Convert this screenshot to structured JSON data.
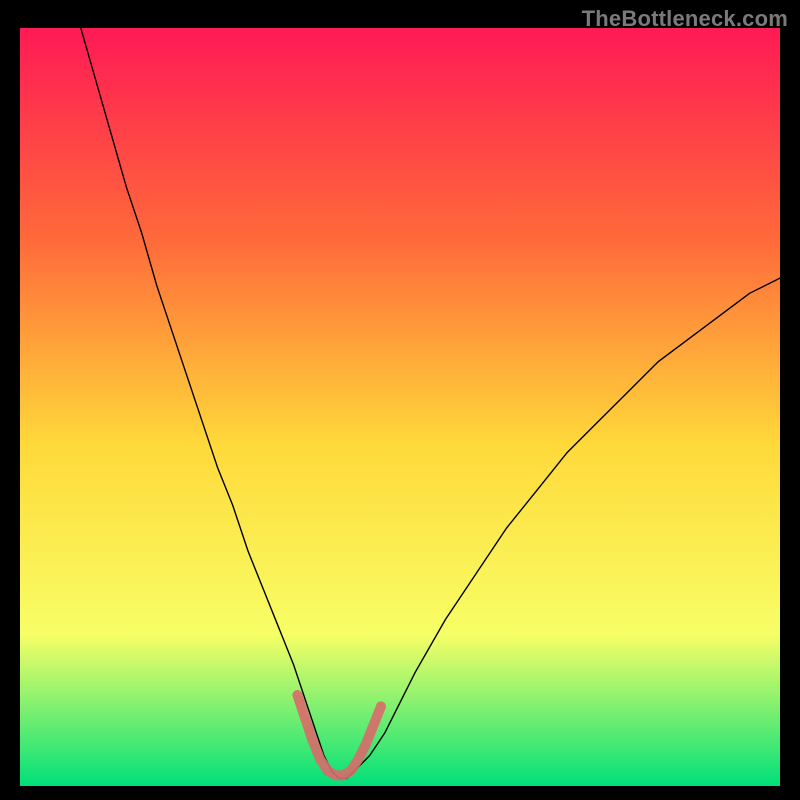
{
  "watermark": "TheBottleneck.com",
  "chart_data": {
    "type": "line",
    "title": "",
    "xlabel": "",
    "ylabel": "",
    "xlim": [
      0,
      100
    ],
    "ylim": [
      0,
      100
    ],
    "grid": false,
    "legend": false,
    "background_gradient": {
      "top": "#ff1a55",
      "mid_upper": "#ff6a3a",
      "mid": "#ffd93a",
      "lower_mid": "#f7ff66",
      "bottom": "#00e07a"
    },
    "series": [
      {
        "name": "bottleneck-curve",
        "stroke": "#000000",
        "stroke_width": 1.4,
        "x": [
          8,
          10,
          12,
          14,
          16,
          18,
          20,
          22,
          24,
          26,
          28,
          30,
          32,
          34,
          36,
          38,
          39,
          40,
          41,
          42,
          43,
          44,
          46,
          48,
          50,
          52,
          56,
          60,
          64,
          68,
          72,
          76,
          80,
          84,
          88,
          92,
          96,
          100
        ],
        "y": [
          100,
          93,
          86,
          79,
          73,
          66,
          60,
          54,
          48,
          42,
          37,
          31,
          26,
          21,
          16,
          10,
          7,
          4,
          2,
          1,
          1,
          2,
          4,
          7,
          11,
          15,
          22,
          28,
          34,
          39,
          44,
          48,
          52,
          56,
          59,
          62,
          65,
          67
        ]
      },
      {
        "name": "valley-highlight",
        "stroke": "#d96a6a",
        "stroke_width": 10,
        "x": [
          36.5,
          37.5,
          38.5,
          39.5,
          40.5,
          41.5,
          42.5,
          43.5,
          44.5,
          45.5,
          46.5,
          47.5
        ],
        "y": [
          12,
          9,
          6,
          3.5,
          2,
          1.4,
          1.4,
          2,
          3.5,
          5.5,
          8,
          10.5
        ]
      }
    ],
    "annotations": []
  }
}
